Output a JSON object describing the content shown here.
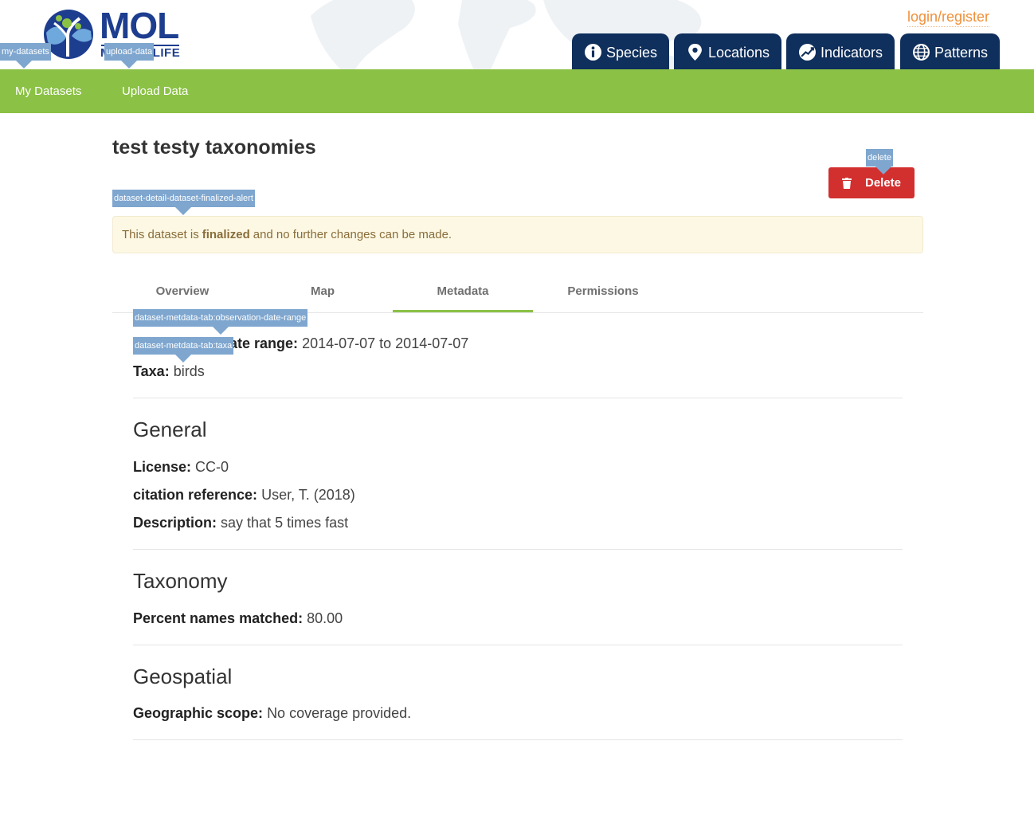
{
  "header": {
    "logo_title": "MOL",
    "logo_subtitle": "MAP OF LIFE",
    "login_label": "login/register",
    "nav": [
      {
        "label": "Species",
        "icon": "info-icon"
      },
      {
        "label": "Locations",
        "icon": "map-pin-icon"
      },
      {
        "label": "Indicators",
        "icon": "trend-chart-icon"
      },
      {
        "label": "Patterns",
        "icon": "globe-grid-icon"
      }
    ]
  },
  "subnav": {
    "my_datasets": "My Datasets",
    "upload_data": "Upload Data"
  },
  "tooltips": {
    "my_datasets": "my-datasets",
    "upload_data": "upload-data",
    "delete": "delete",
    "finalized_alert": "dataset-detail-dataset-finalized-alert",
    "observation_date_range": "dataset-metdata-tab:observation-date-range",
    "taxa": "dataset-metdata-tab:taxa"
  },
  "dataset": {
    "title": "test testy taxonomies",
    "delete_label": "Delete",
    "alert": {
      "prefix": "This dataset is",
      "emphasis": "finalized",
      "suffix": "and no further changes can be made."
    }
  },
  "tabs": {
    "overview": "Overview",
    "map": "Map",
    "metadata": "Metadata",
    "permissions": "Permissions",
    "active": "Metadata"
  },
  "metadata": {
    "observation_label": "Observation date range:",
    "observation_value": "2014-07-07 to 2014-07-07",
    "taxa_label": "Taxa:",
    "taxa_value": "birds",
    "general": {
      "heading": "General",
      "license_label": "License:",
      "license_value": "CC-0",
      "citation_label": "citation reference:",
      "citation_value": "User, T. (2018)",
      "description_label": "Description:",
      "description_value": "say that 5 times fast"
    },
    "taxonomy": {
      "heading": "Taxonomy",
      "percent_label": "Percent names matched:",
      "percent_value": "80.00"
    },
    "geospatial": {
      "heading": "Geospatial",
      "scope_label": "Geographic scope:",
      "scope_value": "No coverage provided."
    }
  },
  "colors": {
    "nav_dark": "#0f2f5c",
    "green": "#8bc145",
    "login_orange": "#f0903a",
    "delete_red": "#d22f2f",
    "tooltip_blue": "#7ea6cf",
    "alert_bg": "#fcf8e3"
  }
}
